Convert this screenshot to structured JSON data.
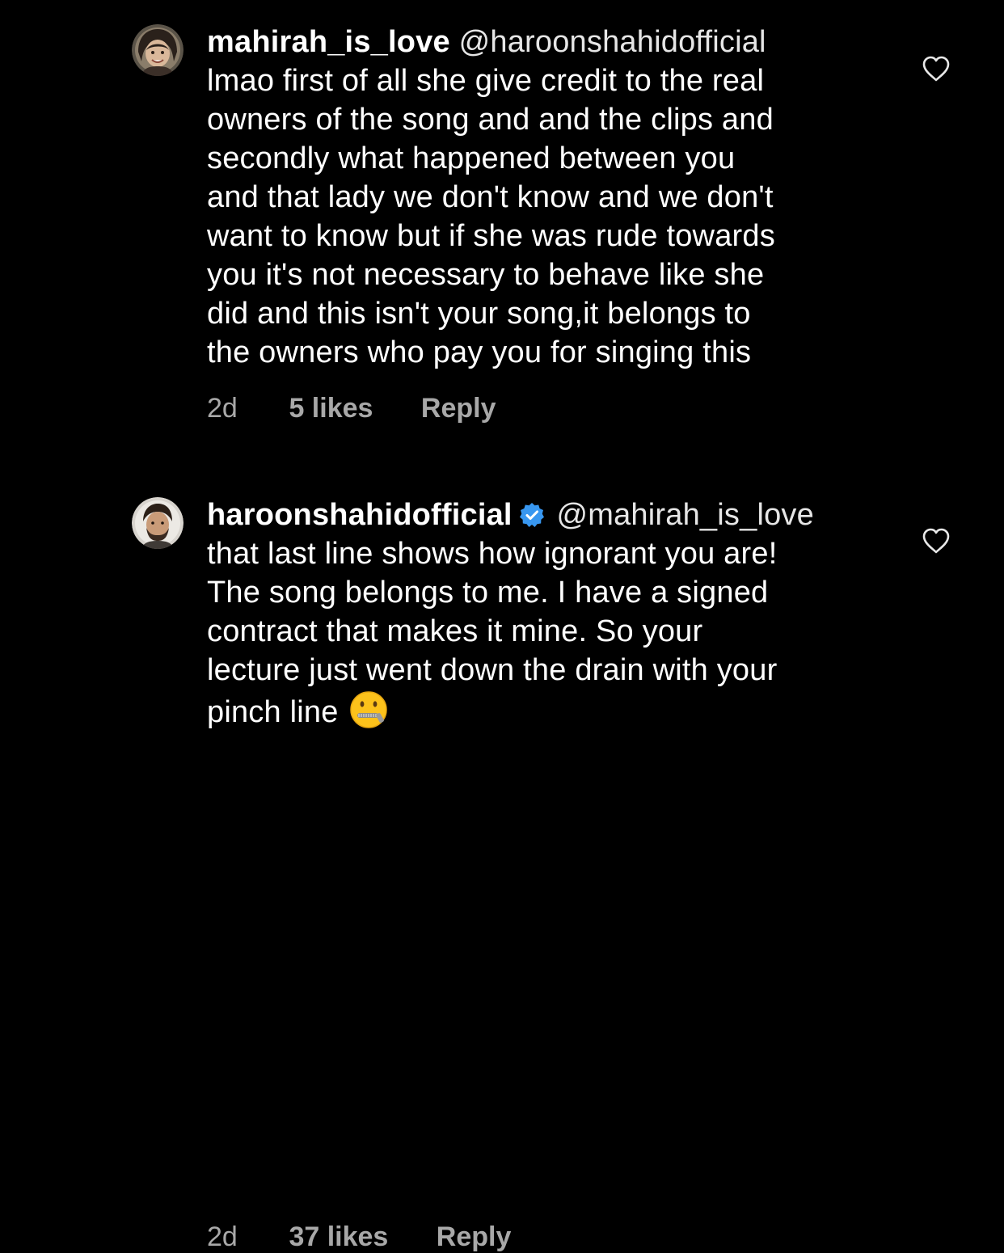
{
  "comments": [
    {
      "username": "mahirah_is_love",
      "verified": false,
      "mention": "@haroonshahidofficial",
      "lines": [
        "lmao first of all she give credit to the real",
        "owners of the song and and the clips and",
        "secondly what happened between you",
        "and that lady we don't know and we don't",
        "want to know but if she was rude towards",
        "you it's not necessary to behave like she",
        "did and this isn't your song,it belongs to",
        "the owners who pay you for singing this"
      ],
      "time": "2d",
      "likes": "5 likes",
      "reply_label": "Reply"
    },
    {
      "username": "haroonshahidofficial",
      "verified": true,
      "mention": "@mahirah_is_love",
      "lines": [
        "that last line shows how ignorant you are!",
        "The song belongs to me. I have a signed",
        "contract that makes it mine. So your",
        "lecture just went down the drain with your",
        "pinch line"
      ],
      "emoji": "zipper-mouth-face",
      "time": "2d",
      "likes": "37 likes",
      "reply_label": "Reply"
    }
  ],
  "icons": {
    "like": "heart-outline-icon",
    "verified": "verified-badge-icon"
  },
  "colors": {
    "background": "#000000",
    "text": "#ffffff",
    "meta": "#a8a8a8",
    "verified": "#3897f0"
  }
}
